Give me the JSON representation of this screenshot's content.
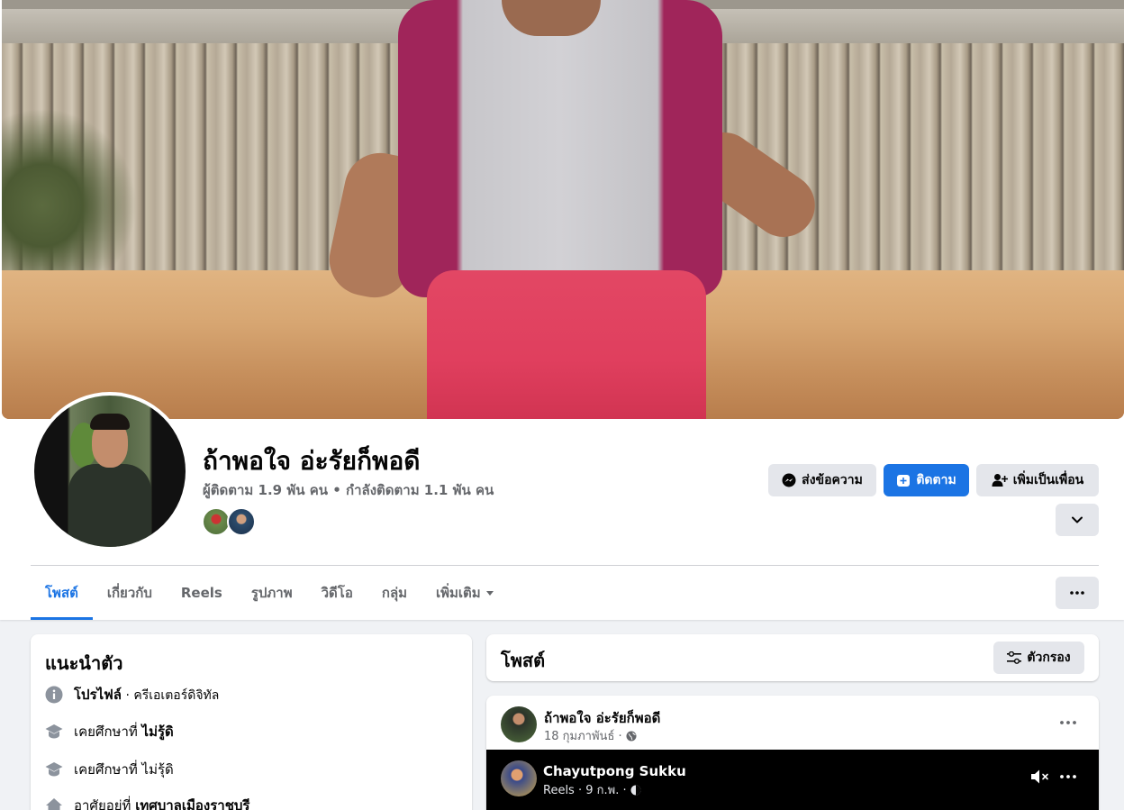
{
  "profile": {
    "name": "ถ้าพอใจ อ่ะรัยก็พอดี",
    "stats": "ผู้ติดตาม 1.9 พัน คน • กำลังติดตาม 1.1 พัน คน"
  },
  "actions": {
    "message_label": "ส่งข้อความ",
    "follow_label": "ติดตาม",
    "add_friend_label": "เพิ่มเป็นเพื่อน"
  },
  "tabs": [
    {
      "label": "โพสต์",
      "active": true
    },
    {
      "label": "เกี่ยวกับ",
      "active": false
    },
    {
      "label": "Reels",
      "active": false
    },
    {
      "label": "รูปภาพ",
      "active": false
    },
    {
      "label": "วิดีโอ",
      "active": false
    },
    {
      "label": "กลุ่ม",
      "active": false
    },
    {
      "label": "เพิ่มเติม",
      "active": false
    }
  ],
  "intro": {
    "title": "แนะนำตัว",
    "rows": [
      {
        "icon": "info-icon",
        "strong": "โปรไฟล์",
        "rest": " · ครีเอเตอร์ดิจิทัล"
      },
      {
        "icon": "graduation-cap-icon",
        "prefix": "เคยศึกษาที่ ",
        "strong": "ไม่รู้ดิ"
      },
      {
        "icon": "graduation-cap-icon",
        "prefix": "เคยศึกษาที่ ",
        "rest": "ไม่รุ้ดิ"
      },
      {
        "icon": "home-icon",
        "prefix": "อาศัยอยู่ที่ ",
        "strong": "เทศบาลเมืองราชบุรี"
      }
    ]
  },
  "posts_section": {
    "title": "โพสต์",
    "filter_label": "ตัวกรอง"
  },
  "post": {
    "author": "ถ้าพอใจ อ่ะรัยก็พอดี",
    "date": "18 กุมภาพันธ์ ·",
    "privacy_icon": "globe-icon",
    "reel": {
      "author": "Chayutpong Sukku",
      "meta": "Reels · 9 ก.พ. ·",
      "privacy_icon": "friends-globe-icon"
    }
  },
  "colors": {
    "accent": "#1b74e4",
    "page_bg": "#f0f2f5",
    "secondary_text": "#65676b",
    "button_gray": "#e4e6eb"
  }
}
